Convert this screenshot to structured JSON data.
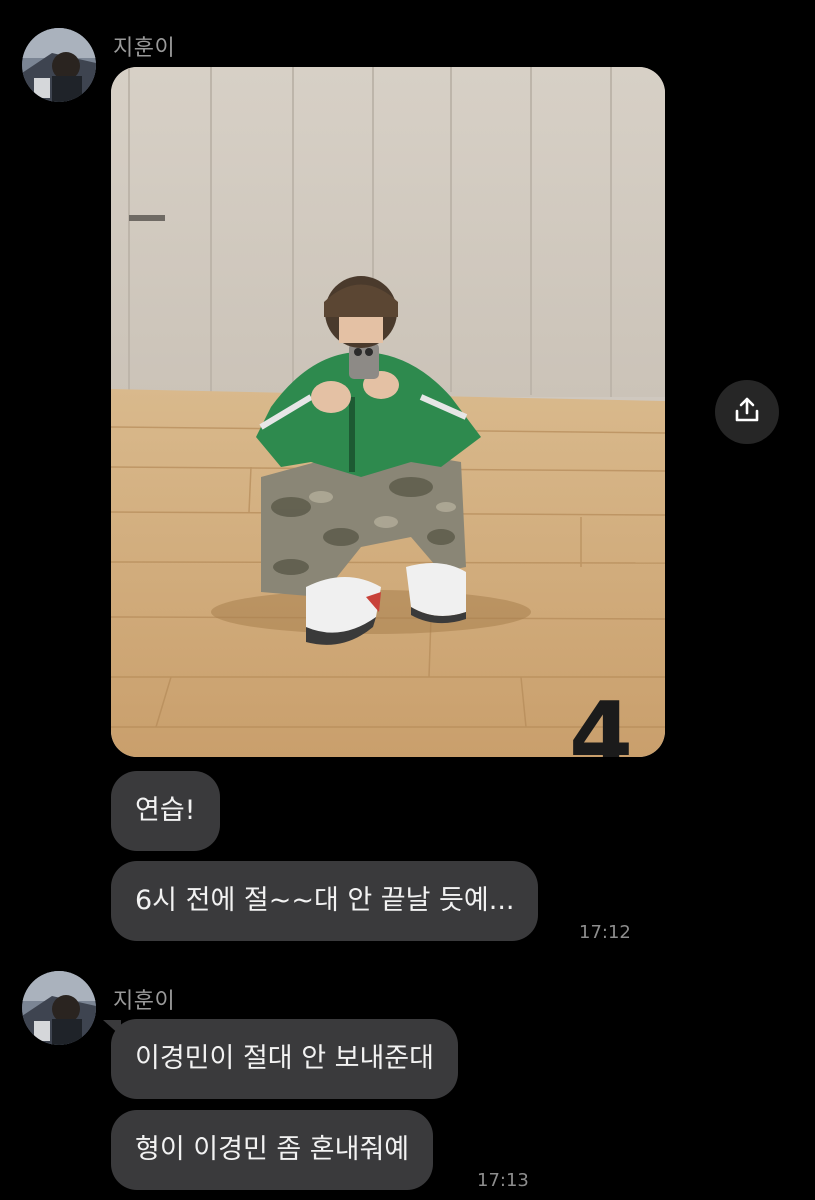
{
  "groups": [
    {
      "sender": "지훈이",
      "timestamp": "17:12",
      "messages": [
        "연습!",
        "6시 전에 절~~대 안 끝날 듯예..."
      ]
    },
    {
      "sender": "지훈이",
      "timestamp": "17:13",
      "messages": [
        "이경민이 절대 안 보내준대",
        "형이 이경민 좀 혼내줘예"
      ]
    }
  ],
  "photo": {
    "overlay_number": "4"
  },
  "icons": {
    "share": "share-upload-icon",
    "avatar": "profile-avatar"
  },
  "colors": {
    "background": "#000000",
    "bubble": "#3a3a3c",
    "bubble_text": "#f2f2f2",
    "sender_text": "#9a9a9a",
    "timestamp_text": "#8d8d8d",
    "share_button": "#262626"
  }
}
